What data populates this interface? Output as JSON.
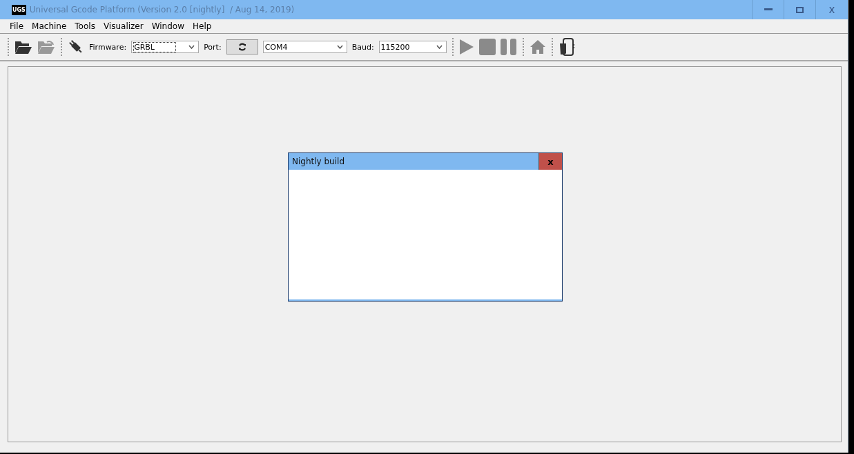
{
  "window": {
    "title": "Universal Gcode Platform (Version 2.0 [nightly]  / Aug 14, 2019)",
    "logo": "UGS",
    "close": "x"
  },
  "menu": [
    "File",
    "Machine",
    "Tools",
    "Visualizer",
    "Window",
    "Help"
  ],
  "toolbar": {
    "firmware_label": "Firmware:",
    "firmware": "GRBL",
    "port_label": "Port:",
    "port": "COM4",
    "baud_label": "Baud:",
    "baud": "115200"
  },
  "dialog": {
    "title": "Nightly build",
    "close": "x"
  }
}
